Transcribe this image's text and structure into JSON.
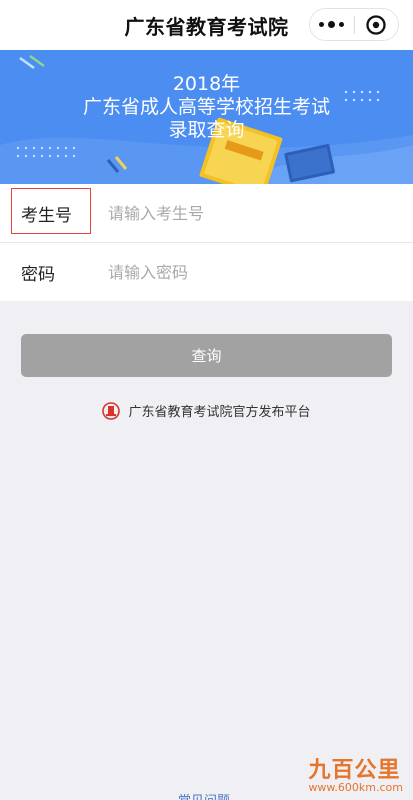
{
  "header": {
    "title": "广东省教育考试院"
  },
  "banner": {
    "year": "2018年",
    "line1": "广东省成人高等学校招生考试",
    "line2": "录取查询"
  },
  "form": {
    "exam_number": {
      "label": "考生号",
      "placeholder": "请输入考生号"
    },
    "password": {
      "label": "密码",
      "placeholder": "请输入密码"
    }
  },
  "actions": {
    "query_label": "查询"
  },
  "official": {
    "text": "广东省教育考试院官方发布平台"
  },
  "footer": {
    "faq_label": "常见问题"
  },
  "watermark": {
    "text": "九百公里",
    "url": "www.600km.com"
  },
  "icons": {
    "more": "more-dots-icon",
    "close": "close-circle-icon",
    "official": "official-logo-icon"
  },
  "colors": {
    "banner": "#4b8df0",
    "button_disabled": "#a2a2a2",
    "highlight": "#e8413b",
    "link": "#4a78c8"
  }
}
